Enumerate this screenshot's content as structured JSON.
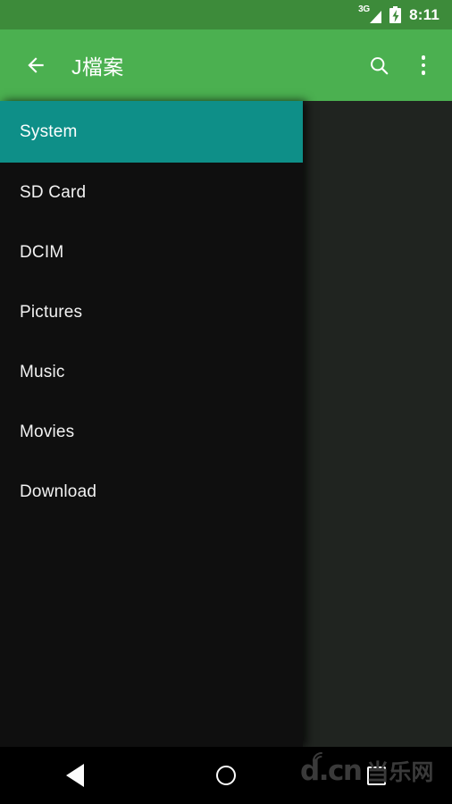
{
  "statusbar": {
    "network": "3G",
    "time": "8:11",
    "signal_icon": "signal-triangle-icon",
    "battery_icon": "battery-charging-icon"
  },
  "appbar": {
    "back_icon": "arrow-back-icon",
    "title": "J檔案",
    "search_icon": "search-icon",
    "overflow_icon": "more-vert-icon",
    "background_color": "#4bb050"
  },
  "drawer": {
    "background_color": "#0f0f0f",
    "active_color": "#0e8f88",
    "items": [
      {
        "label": "System",
        "active": true
      },
      {
        "label": "SD Card",
        "active": false
      },
      {
        "label": "DCIM",
        "active": false
      },
      {
        "label": "Pictures",
        "active": false
      },
      {
        "label": "Music",
        "active": false
      },
      {
        "label": "Movies",
        "active": false
      },
      {
        "label": "Download",
        "active": false
      }
    ]
  },
  "content": {
    "background_color": "#202420"
  },
  "navbar": {
    "back_icon": "nav-back-triangle-icon",
    "home_icon": "nav-home-circle-icon",
    "recents_icon": "nav-recents-square-icon"
  },
  "watermark": {
    "latin": "d.cn",
    "chinese": "当乐网",
    "color": "#3a3a3a"
  }
}
